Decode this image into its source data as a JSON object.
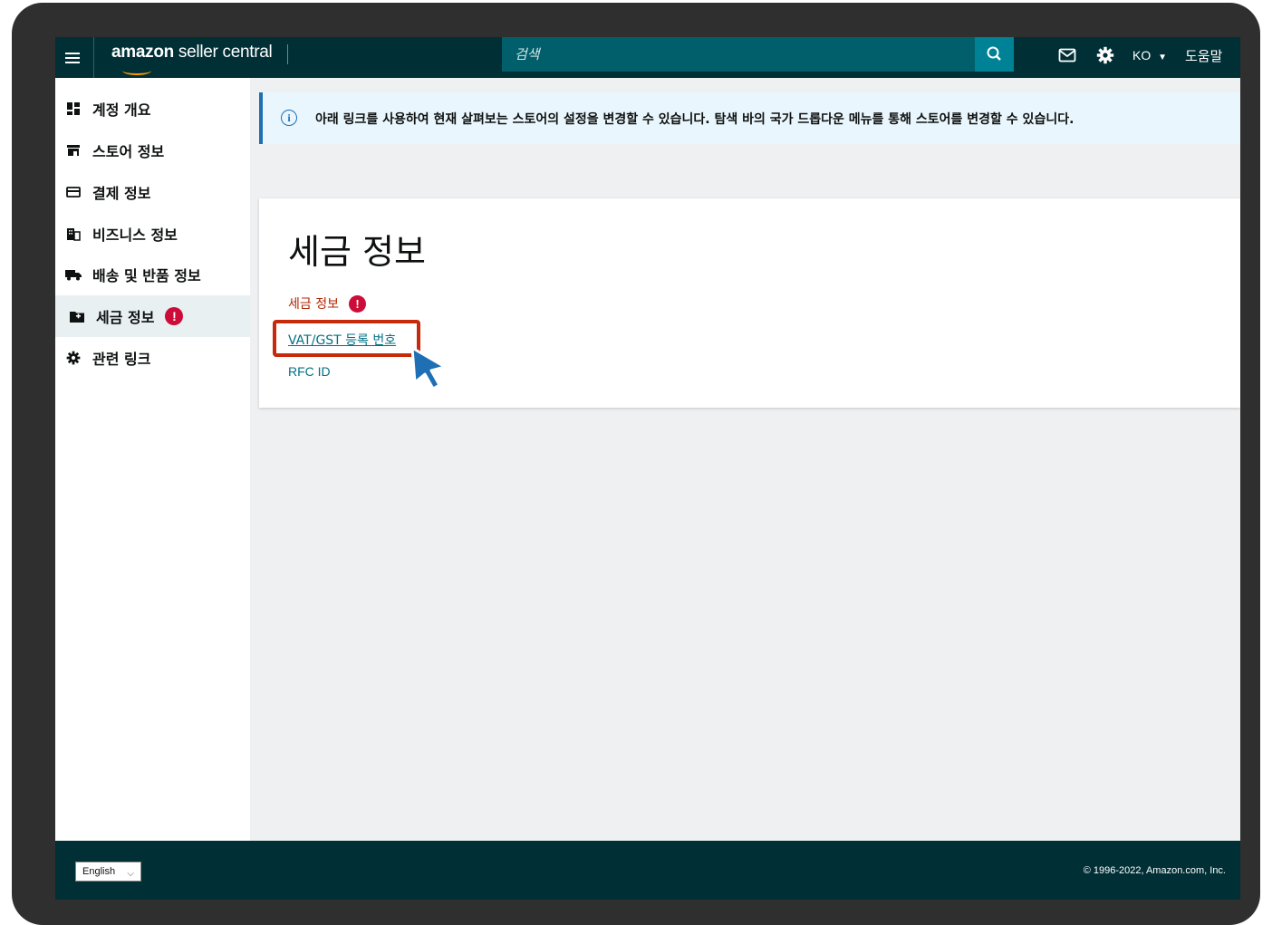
{
  "header": {
    "logo_bold": "amazon",
    "logo_rest": " seller central",
    "search_placeholder": "검색",
    "language": "KO",
    "help": "도움말"
  },
  "sidebar": {
    "items": [
      {
        "label": "계정 개요",
        "icon": "dashboard-icon"
      },
      {
        "label": "스토어 정보",
        "icon": "store-icon"
      },
      {
        "label": "결제 정보",
        "icon": "credit-card-icon"
      },
      {
        "label": "비즈니스 정보",
        "icon": "building-icon"
      },
      {
        "label": "배송 및 반품 정보",
        "icon": "truck-icon"
      },
      {
        "label": "세금 정보",
        "icon": "tax-folder-icon",
        "active": true,
        "alert": "!"
      },
      {
        "label": "관련 링크",
        "icon": "gear-icon"
      }
    ]
  },
  "banner": {
    "text": "아래 링크를 사용하여 현재 살펴보는 스토어의 설정을 변경할 수 있습니다. 탐색 바의 국가 드롭다운 메뉴를 통해 스토어를 변경할 수 있습니다."
  },
  "card": {
    "title": "세금 정보",
    "links": [
      {
        "label": "세금 정보",
        "alert": "!"
      },
      {
        "label": "VAT/GST 등록 번호"
      },
      {
        "label": "RFC ID"
      }
    ]
  },
  "footer": {
    "language_select": "English",
    "copyright": "© 1996-2022, Amazon.com, Inc."
  },
  "colors": {
    "nav_bg": "#002f36",
    "search_bg": "#005f6b",
    "search_button": "#008296",
    "link": "#007185",
    "alert": "#cc0c39",
    "highlight": "#c7290b"
  }
}
